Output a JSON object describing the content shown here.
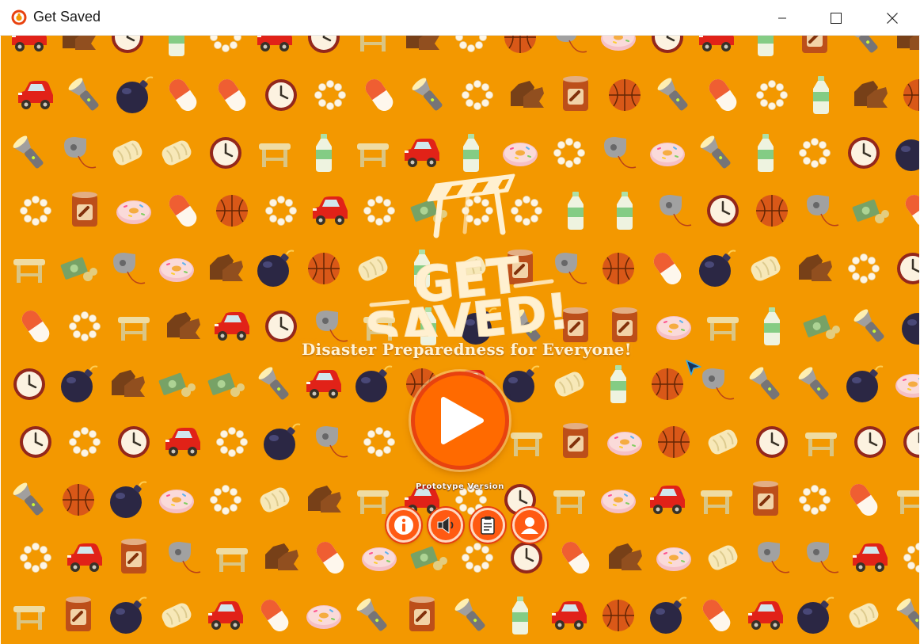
{
  "window": {
    "title": "Get Saved",
    "controls": [
      "minimize-icon",
      "maximize-icon",
      "close-icon"
    ]
  },
  "colors": {
    "background": "#f39800",
    "play_button": "#ff6a00",
    "round_button": "#ff5a12",
    "logo_text": "#fff0d0"
  },
  "game": {
    "logo_line1": "GET",
    "logo_line2": "SAVED!",
    "tagline": "Disaster Preparedness for Everyone!",
    "version_label": "Prototype Version",
    "play_icon": "play-icon",
    "buttons": [
      {
        "name": "info-button",
        "icon": "info-icon"
      },
      {
        "name": "sound-button",
        "icon": "speaker-icon"
      },
      {
        "name": "clipboard-button",
        "icon": "clipboard-icon"
      },
      {
        "name": "profile-button",
        "icon": "person-icon"
      }
    ],
    "background_items": [
      "bomb-icon",
      "clock-icon",
      "flashlight-icon",
      "water-bottle-icon",
      "basketball-icon",
      "bread-icon",
      "pearl-necklace-icon",
      "toy-car-icon",
      "boots-icon",
      "donut-icon",
      "canned-food-icon",
      "whistle-icon",
      "money-icon",
      "stool-icon",
      "pill-icon"
    ]
  }
}
